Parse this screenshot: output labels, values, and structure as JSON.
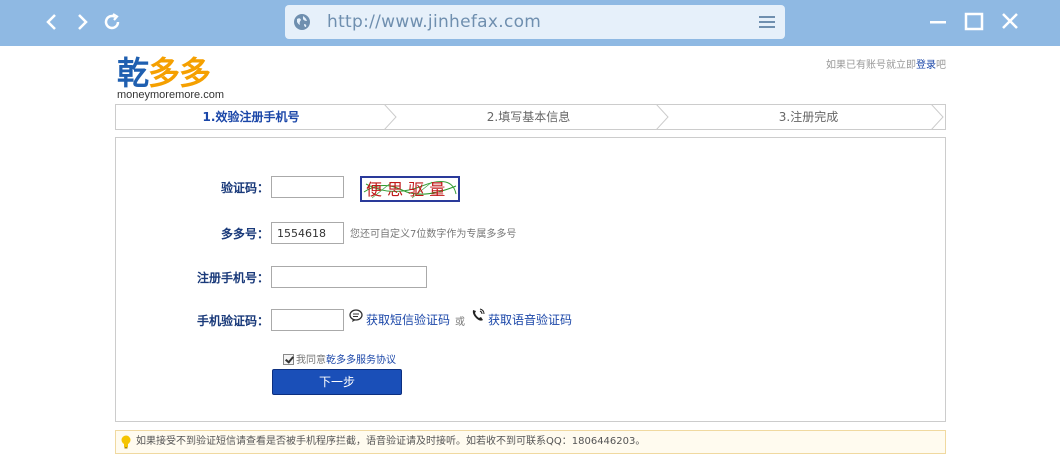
{
  "browser": {
    "url": "http://www.jinhefax.com"
  },
  "header": {
    "logo_main_1": "乾",
    "logo_main_2": "多多",
    "logo_sub": "moneymoremore.com",
    "login_prefix": "如果已有账号就立即",
    "login_link": "登录",
    "login_suffix": "吧"
  },
  "steps": [
    {
      "label": "1.效验注册手机号",
      "active": true
    },
    {
      "label": "2.填写基本信息",
      "active": false
    },
    {
      "label": "3.注册完成",
      "active": false
    }
  ],
  "form": {
    "captcha_label": "验证码：",
    "captcha_value": "",
    "captcha_image_text": "便 思 驱 量",
    "duoduo_label": "多多号：",
    "duoduo_value": "1554618",
    "duoduo_hint": "您还可自定义7位数字作为专属多多号",
    "phone_label": "注册手机号：",
    "phone_value": "",
    "sms_label": "手机验证码：",
    "sms_value": "",
    "sms_link": "获取短信验证码",
    "or_text": "或",
    "voice_link": "获取语音验证码",
    "agree_text": "我同意",
    "agree_link": "乾多多服务协议",
    "agree_checked": true,
    "next_button": "下一步"
  },
  "tip": {
    "text": "如果接受不到验证短信请查看是否被手机程序拦截，语音验证请及时接听。如若收不到可联系QQ：1806446203。"
  },
  "colors": {
    "chrome": "#8fb9e3",
    "brand_blue": "#1f5fb0",
    "brand_orange": "#f5a000",
    "button": "#1a4fb8"
  }
}
